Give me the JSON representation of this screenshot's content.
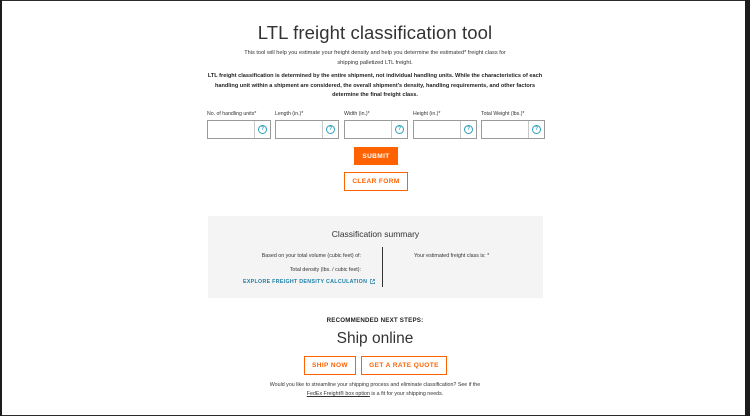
{
  "page": {
    "title": "LTL freight classification tool",
    "intro": "This tool will help you estimate your freight density and help you determine the estimated* freight class for shipping palletized LTL freight.",
    "bold_note": "LTL freight classification is determined by the entire shipment, not individual handling units. While the characteristics of each handling unit within a shipment are considered, the overall shipment's density, handling requirements, and other factors determine the final freight class."
  },
  "form": {
    "fields": [
      {
        "label": "No. of handling units*",
        "value": ""
      },
      {
        "label": "Length (in.)*",
        "value": ""
      },
      {
        "label": "Width (in.)*",
        "value": ""
      },
      {
        "label": "Height (in.)*",
        "value": ""
      },
      {
        "label": "Total Weight (lbs.)*",
        "value": ""
      }
    ],
    "help_glyph": "?",
    "submit_label": "SUBMIT",
    "clear_label": "CLEAR FORM"
  },
  "summary": {
    "title": "Classification summary",
    "volume_label": "Based on your total volume (cubic feet) of:",
    "density_label": "Total density (lbs. / cubic feet):",
    "link_label": "EXPLORE FREIGHT DENSITY CALCULATION",
    "estimate_label": "Your estimated freight class is: *"
  },
  "next_steps": {
    "heading": "RECOMMENDED NEXT STEPS:",
    "ship_title": "Ship online",
    "ship_now_label": "SHIP NOW",
    "rate_quote_label": "GET A RATE QUOTE",
    "footer_text_1": "Would you like to streamline your shipping process and eliminate classification? See if the",
    "footer_link": "FedEx Freight® box option",
    "footer_text_2": "is a fit for your shipping needs."
  },
  "colors": {
    "accent": "#ff6200",
    "link": "#1d7fa6",
    "help_icon": "#2aa0b8",
    "summary_bg": "#f4f4f4"
  }
}
